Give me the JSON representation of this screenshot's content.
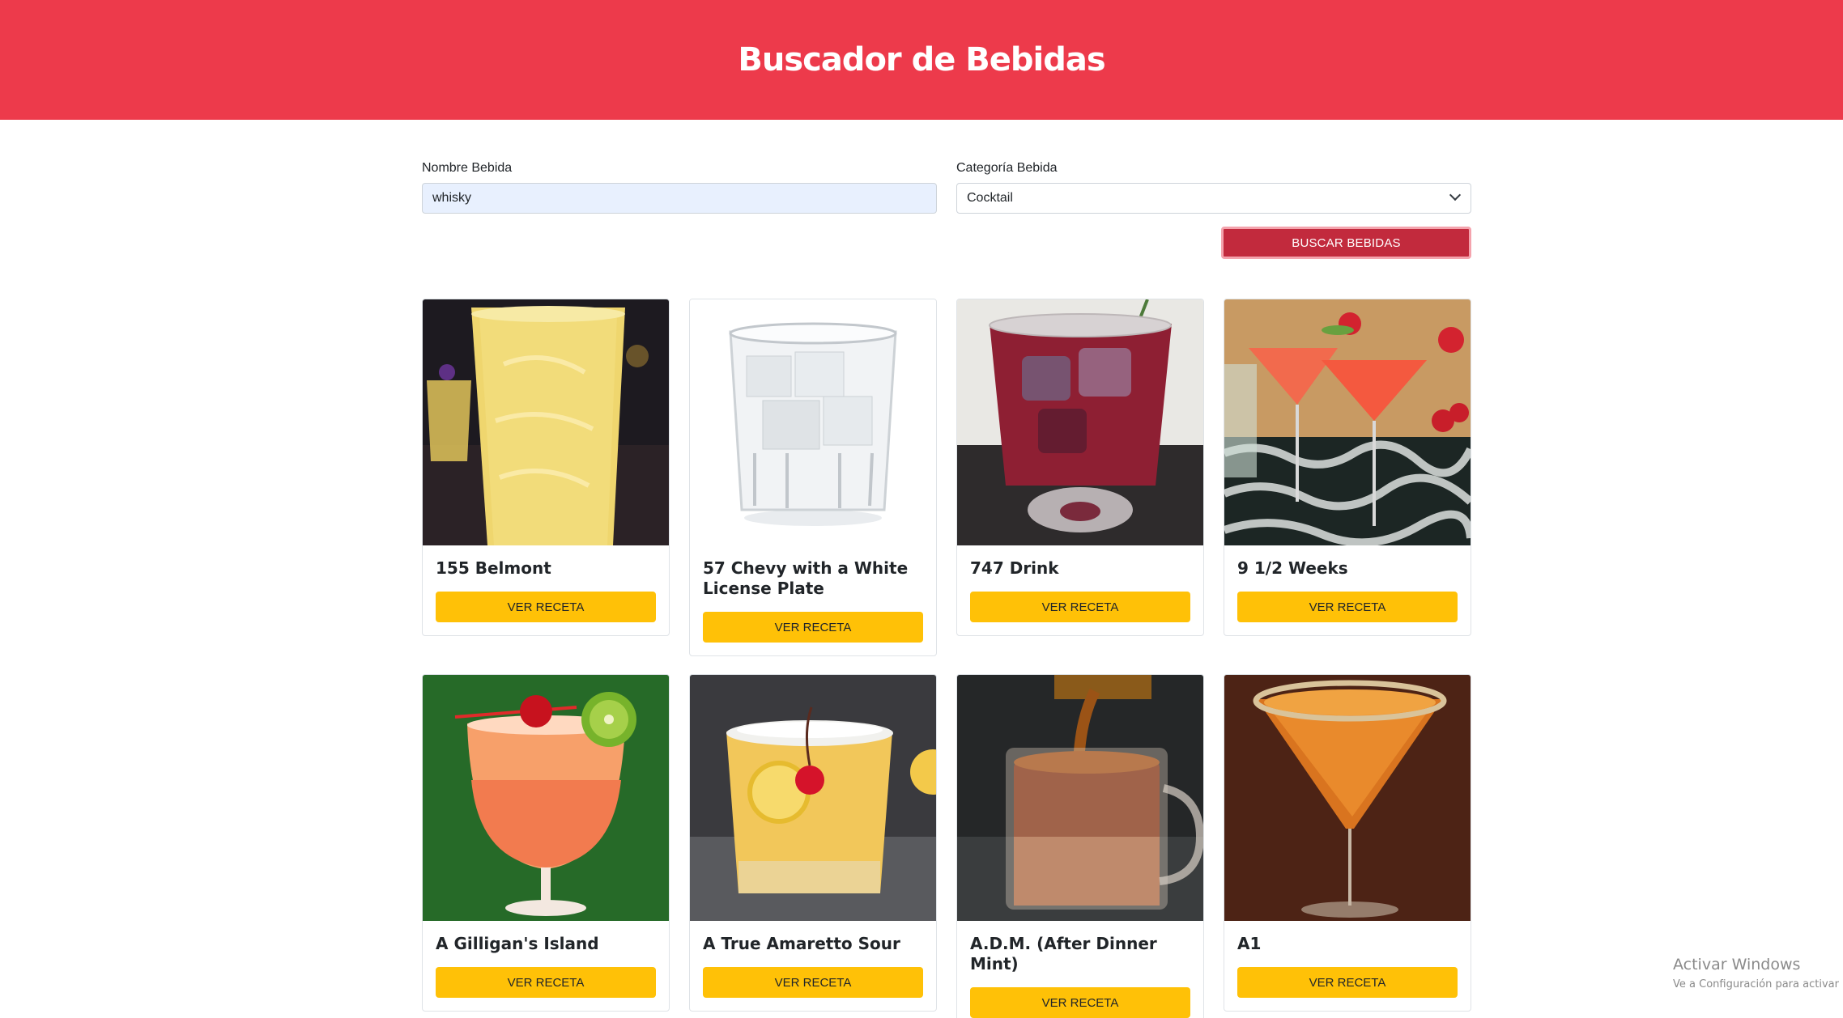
{
  "header": {
    "title": "Buscador de Bebidas"
  },
  "form": {
    "name_label": "Nombre Bebida",
    "name_value": "whisky",
    "category_label": "Categoría Bebida",
    "category_value": "Cocktail",
    "search_button": "Buscar Bebidas"
  },
  "drinks": [
    {
      "name": "155 Belmont",
      "button": "Ver Receta"
    },
    {
      "name": "57 Chevy with a White License Plate",
      "button": "Ver Receta"
    },
    {
      "name": "747 Drink",
      "button": "Ver Receta"
    },
    {
      "name": "9 1/2 Weeks",
      "button": "Ver Receta"
    },
    {
      "name": "A Gilligan's Island",
      "button": "Ver Receta"
    },
    {
      "name": "A True Amaretto Sour",
      "button": "Ver Receta"
    },
    {
      "name": "A.D.M. (After Dinner Mint)",
      "button": "Ver Receta"
    },
    {
      "name": "A1",
      "button": "Ver Receta"
    }
  ],
  "watermark": {
    "line1": "Activar Windows",
    "line2": "Ve a Configuración para activar"
  },
  "colors": {
    "header": "#ed3a4b",
    "search_button": "#c22a3d",
    "card_button": "#ffc107"
  }
}
